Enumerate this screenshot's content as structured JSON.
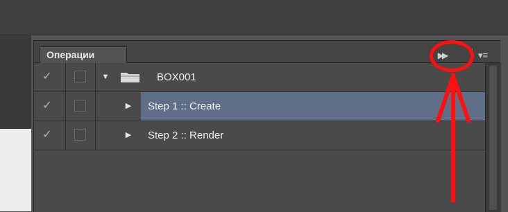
{
  "panel": {
    "tab_label": "Операции",
    "collapse_icon": "double-chevron-right-icon",
    "menu_icon": "panel-menu-icon"
  },
  "rows": [
    {
      "label": "BOX001",
      "type": "set",
      "expanded": true,
      "enabled": true,
      "selected": false
    },
    {
      "label": "Step 1 :: Create",
      "type": "action",
      "expanded": false,
      "enabled": true,
      "selected": true
    },
    {
      "label": "Step 2 :: Render",
      "type": "action",
      "expanded": false,
      "enabled": true,
      "selected": false
    }
  ],
  "glyphs": {
    "check": "✓",
    "expanded": "▼",
    "collapsed": "▶",
    "collapse_panel": "▶▶",
    "menu": "▾≡"
  },
  "colors": {
    "panel_bg": "#4a4a4a",
    "selection": "#5f6f87",
    "annotation": "#ff0f0f"
  }
}
